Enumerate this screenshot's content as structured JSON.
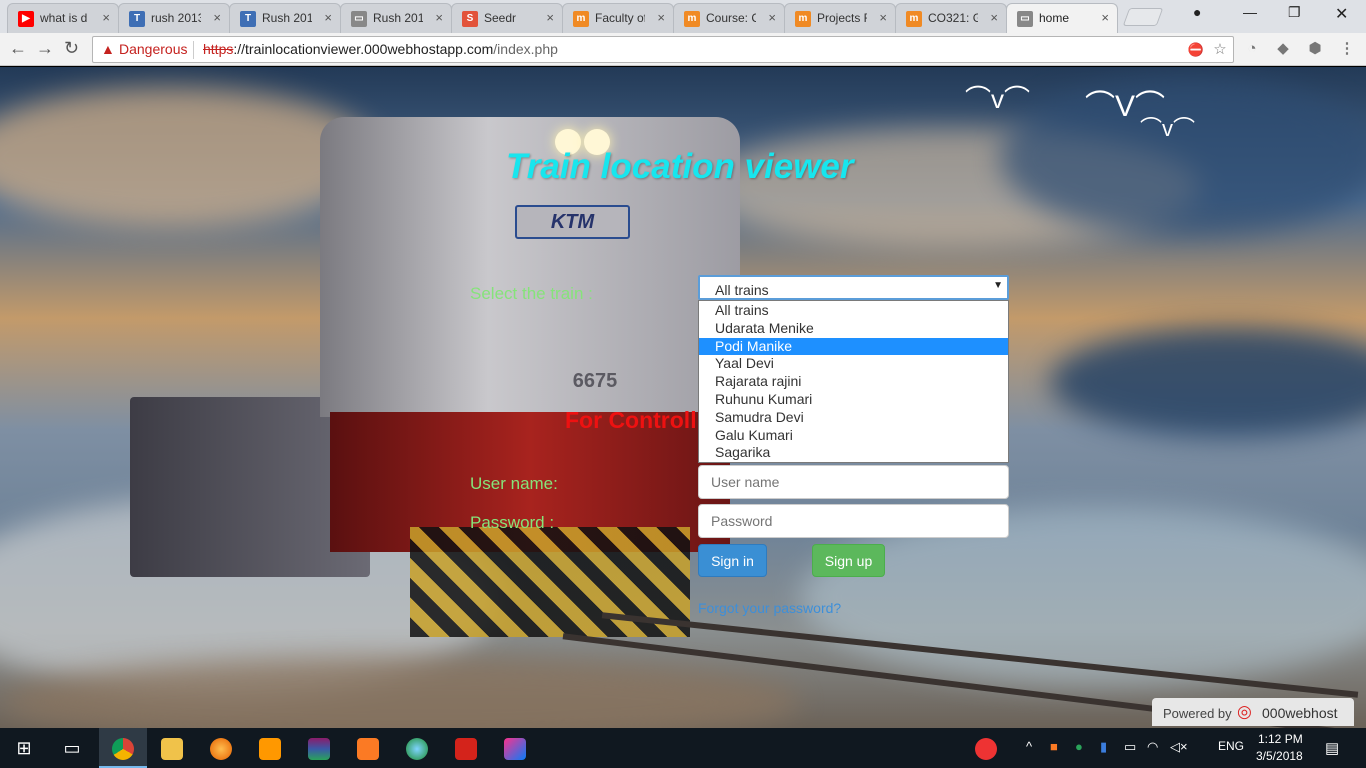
{
  "browser": {
    "tabs": [
      {
        "title": "what is d",
        "icon": "youtube-icon",
        "color": "#ff0000",
        "glyph": "▶"
      },
      {
        "title": "rush 2013",
        "icon": "tab-page-icon",
        "color": "#3f6fb5",
        "glyph": "T"
      },
      {
        "title": "Rush 201",
        "icon": "tab-page-icon",
        "color": "#3f6fb5",
        "glyph": "T"
      },
      {
        "title": "Rush 201",
        "icon": "document-icon",
        "color": "#888888",
        "glyph": "▭"
      },
      {
        "title": "Seedr",
        "icon": "seedr-icon",
        "color": "#e2533a",
        "glyph": "S"
      },
      {
        "title": "Faculty of",
        "icon": "moodle-icon",
        "color": "#f08a24",
        "glyph": "m"
      },
      {
        "title": "Course: C",
        "icon": "moodle-icon",
        "color": "#f08a24",
        "glyph": "m"
      },
      {
        "title": "Projects F",
        "icon": "moodle-icon",
        "color": "#f08a24",
        "glyph": "m"
      },
      {
        "title": "CO321: G",
        "icon": "moodle-icon",
        "color": "#f08a24",
        "glyph": "m"
      },
      {
        "title": "home",
        "icon": "document-icon",
        "color": "#888888",
        "glyph": "▭"
      }
    ],
    "close_glyph": "×",
    "security_label": "Dangerous",
    "url_scheme": "https",
    "url_host": "://trainlocationviewer.000webhostapp.com",
    "url_path": "/index.php"
  },
  "page": {
    "title": "Train location viewer",
    "select_label": "Select the train :",
    "select_value": "All trains",
    "options": [
      "All trains",
      "Udarata Menike",
      "Podi Manike",
      "Yaal Devi",
      "Rajarata rajini",
      "Ruhunu Kumari",
      "Samudra Devi",
      "Galu Kumari",
      "Sagarika"
    ],
    "selected_option": "Podi Manike",
    "controller_heading": "For Controll",
    "username_label": "User name:",
    "username_placeholder": "User name",
    "password_label": "Password :",
    "password_placeholder": "Password",
    "signin_label": "Sign in",
    "signup_label": "Sign up",
    "forgot_label": "Forgot your password?",
    "powered_text": "Powered by",
    "powered_brand": "000webhost",
    "train_plate": "KTM",
    "train_number": "6675"
  },
  "taskbar": {
    "language": "ENG",
    "time": "1:12 PM",
    "date": "3/5/2018"
  },
  "colors": {
    "title": "#17e6ee",
    "labels": "#86e37a",
    "heading": "#ee1111",
    "signin": "#3a8fd4",
    "signup": "#5cb85c",
    "select_highlight": "#1e90ff"
  }
}
